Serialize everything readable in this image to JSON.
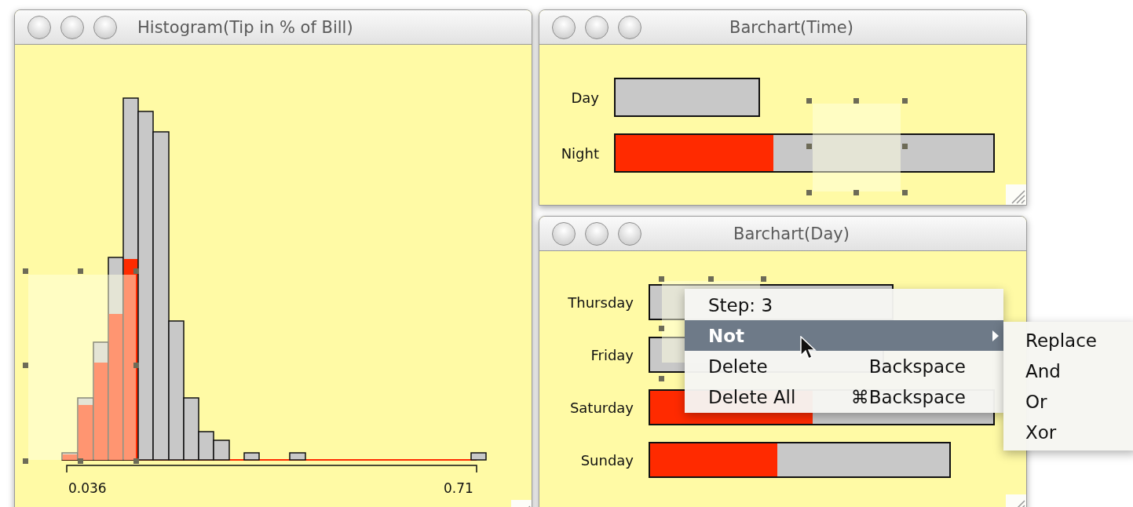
{
  "windows": [
    {
      "kind": "histogram",
      "title": "Histogram(Tip in % of Bill)",
      "axis_labels": [
        "0.036",
        "0.71"
      ]
    },
    {
      "kind": "barchart",
      "title": "Barchart(Time)",
      "rows": [
        {
          "label": "Day"
        },
        {
          "label": "Night"
        }
      ]
    },
    {
      "kind": "barchart",
      "title": "Barchart(Day)",
      "rows": [
        {
          "label": "Thursday"
        },
        {
          "label": "Friday"
        },
        {
          "label": "Saturday"
        },
        {
          "label": "Sunday"
        }
      ]
    }
  ],
  "context_menu": {
    "items": [
      {
        "label": "Step: 3",
        "selected": false,
        "submenu": false
      },
      {
        "label": "Not",
        "selected": true,
        "submenu": true
      },
      {
        "label": "Delete",
        "shortcut": "Backspace",
        "selected": false,
        "submenu": false
      },
      {
        "label": "Delete All",
        "shortcut": "⌘Backspace",
        "selected": false,
        "submenu": false
      }
    ]
  },
  "submenu": {
    "items": [
      "Replace",
      "And",
      "Or",
      "Xor"
    ]
  }
}
